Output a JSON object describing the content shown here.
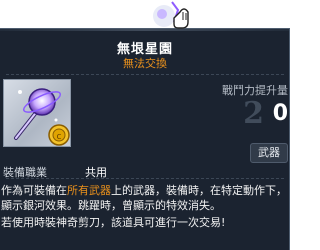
{
  "item": {
    "name": "無垠星園",
    "tradeability": "無法交換",
    "power_label": "戰鬥力提升量",
    "power_value": "0",
    "category": "武器",
    "job_label": "裝備職業",
    "job_value": "共用",
    "description": {
      "part1": "作為可裝備在",
      "highlight": "所有武器",
      "part2": "上的武器，裝備時，在特定動作下，顯示銀河效果。跳躍時，曾顯示的特效消失。"
    },
    "scissors_note": "若使用時裝神奇剪刀，該道具可進行一次交易!"
  },
  "icons": [
    "galaxy-wand-icon",
    "gold-coin-icon",
    "hand-cursor-icon"
  ],
  "colors": {
    "panel_bg": "#1b2330",
    "tradeability": "#e9901c",
    "highlight": "#e9901c",
    "text": "#ffffff"
  }
}
